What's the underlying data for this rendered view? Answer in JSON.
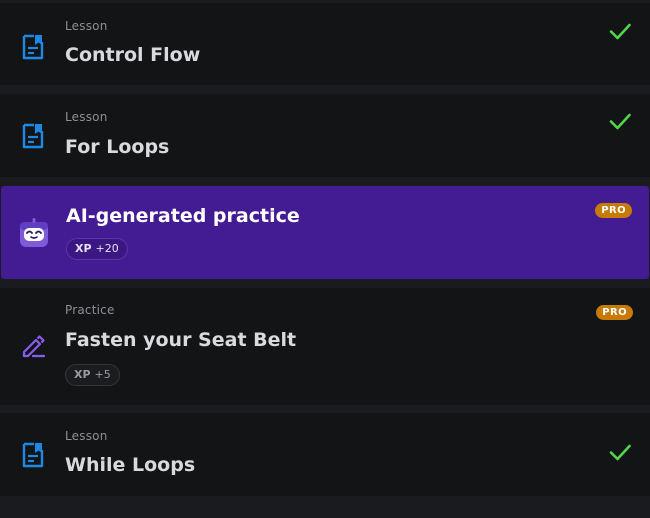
{
  "items": [
    {
      "type": "Lesson",
      "title": "Control Flow",
      "icon": "lesson-document-icon",
      "completed": true
    },
    {
      "type": "Lesson",
      "title": "For Loops",
      "icon": "lesson-document-icon",
      "completed": true
    },
    {
      "title": "AI-generated practice",
      "icon": "ai-robot-icon",
      "badge": "PRO",
      "xp_label": "XP",
      "xp_value": "+20",
      "highlighted": true
    },
    {
      "type": "Practice",
      "title": "Fasten your Seat Belt",
      "icon": "pencil-edit-icon",
      "badge": "PRO",
      "xp_label": "XP",
      "xp_value": "+5"
    },
    {
      "type": "Lesson",
      "title": "While Loops",
      "icon": "lesson-document-icon",
      "completed": true
    }
  ],
  "colors": {
    "accent_purple": "#431b93",
    "check_green": "#52d64b",
    "pro_orange": "#c77a06",
    "lesson_icon_blue": "#1e88e5",
    "practice_icon_purple": "#8a5cf5"
  }
}
